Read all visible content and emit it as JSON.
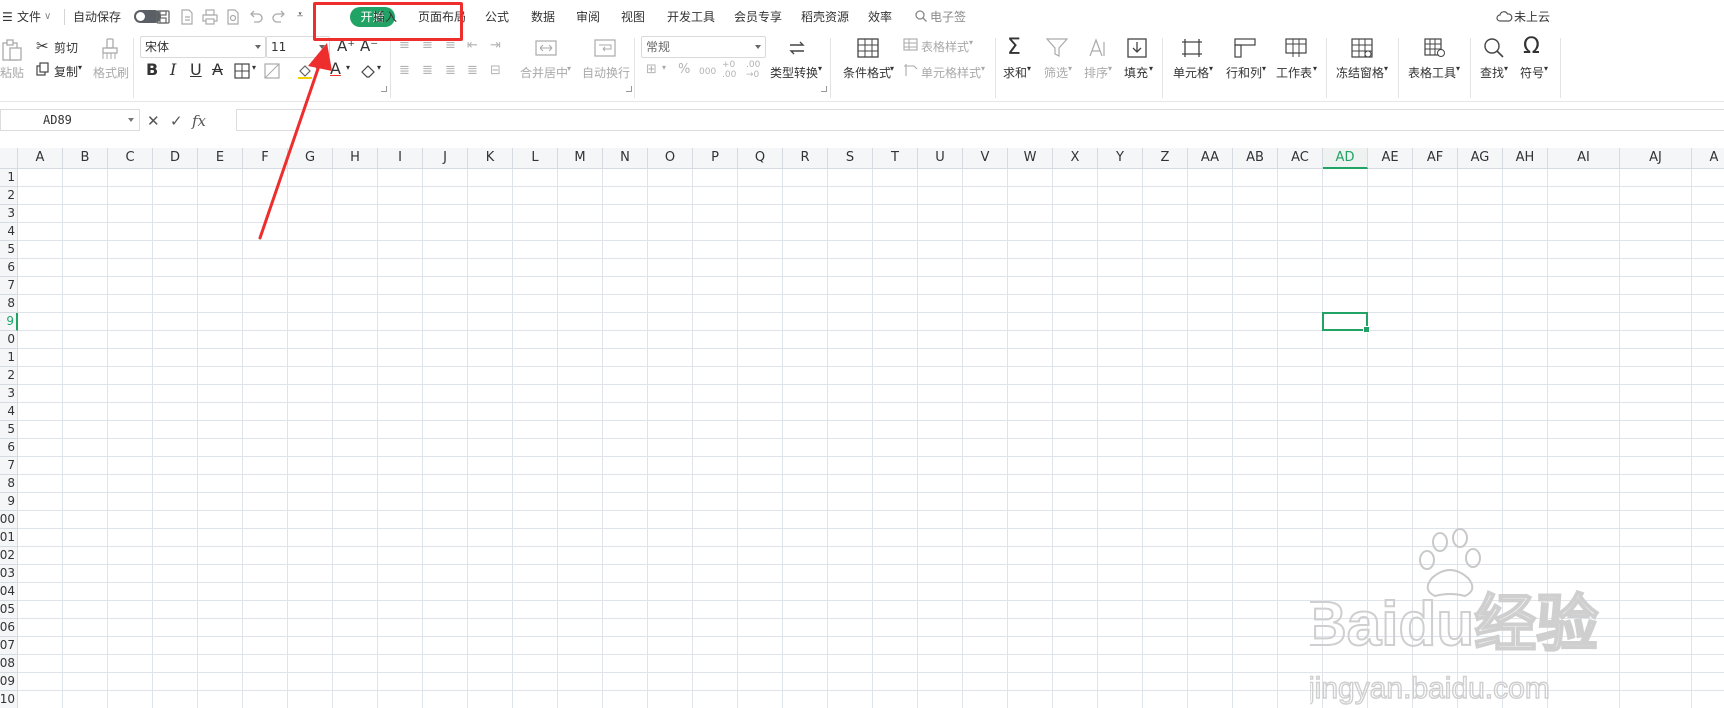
{
  "menubar": {
    "file_label": "文件",
    "autosave_label": "自动保存",
    "tabs": [
      {
        "label": "开始",
        "active": true
      },
      {
        "label": "插入"
      },
      {
        "label": "页面布局"
      },
      {
        "label": "公式"
      },
      {
        "label": "数据"
      },
      {
        "label": "审阅"
      },
      {
        "label": "视图"
      },
      {
        "label": "开发工具"
      },
      {
        "label": "会员专享"
      },
      {
        "label": "稻壳资源"
      },
      {
        "label": "效率"
      }
    ],
    "search_label": "电子签",
    "cloud_status": "未上云"
  },
  "ribbon": {
    "paste_label": "粘贴",
    "cut_label": "剪切",
    "copy_label": "复制",
    "format_painter_label": "格式刷",
    "font_name": "宋体",
    "font_size": "11",
    "merge_label": "合并居中",
    "wrap_label": "自动换行",
    "number_format": "常规",
    "type_convert_label": "类型转换",
    "conditional_format_label": "条件格式",
    "table_style_label": "表格样式",
    "cell_style_label": "单元格样式",
    "sum_label": "求和",
    "filter_label": "筛选",
    "sort_label": "排序",
    "fill_label": "填充",
    "cell_label": "单元格",
    "rowcol_label": "行和列",
    "worksheet_label": "工作表",
    "freeze_label": "冻结窗格",
    "table_tools_label": "表格工具",
    "find_label": "查找",
    "symbol_label": "符号"
  },
  "formula_bar": {
    "name_box": "AD89",
    "fx_label": "fx",
    "formula": ""
  },
  "grid": {
    "columns": [
      "A",
      "B",
      "C",
      "D",
      "E",
      "F",
      "G",
      "H",
      "I",
      "J",
      "K",
      "L",
      "M",
      "N",
      "O",
      "P",
      "Q",
      "R",
      "S",
      "T",
      "U",
      "V",
      "W",
      "X",
      "Y",
      "Z",
      "AA",
      "AB",
      "AC",
      "AD",
      "AE",
      "AF",
      "AG",
      "AH",
      "AI",
      "AJ",
      "A"
    ],
    "active_column": "AD",
    "rows": [
      "1",
      "2",
      "3",
      "4",
      "5",
      "6",
      "7",
      "8",
      "9",
      "0",
      "1",
      "2",
      "3",
      "4",
      "5",
      "6",
      "7",
      "8",
      "9",
      "00",
      "01",
      "02",
      "03",
      "04",
      "05",
      "06",
      "07",
      "08",
      "09",
      "10"
    ],
    "active_row_index": 8
  },
  "watermark": {
    "brand": "Baidu经验",
    "url": "jingyan.baidu.com"
  },
  "colors": {
    "accent": "#21a366",
    "annotation": "#ee2d2d"
  }
}
